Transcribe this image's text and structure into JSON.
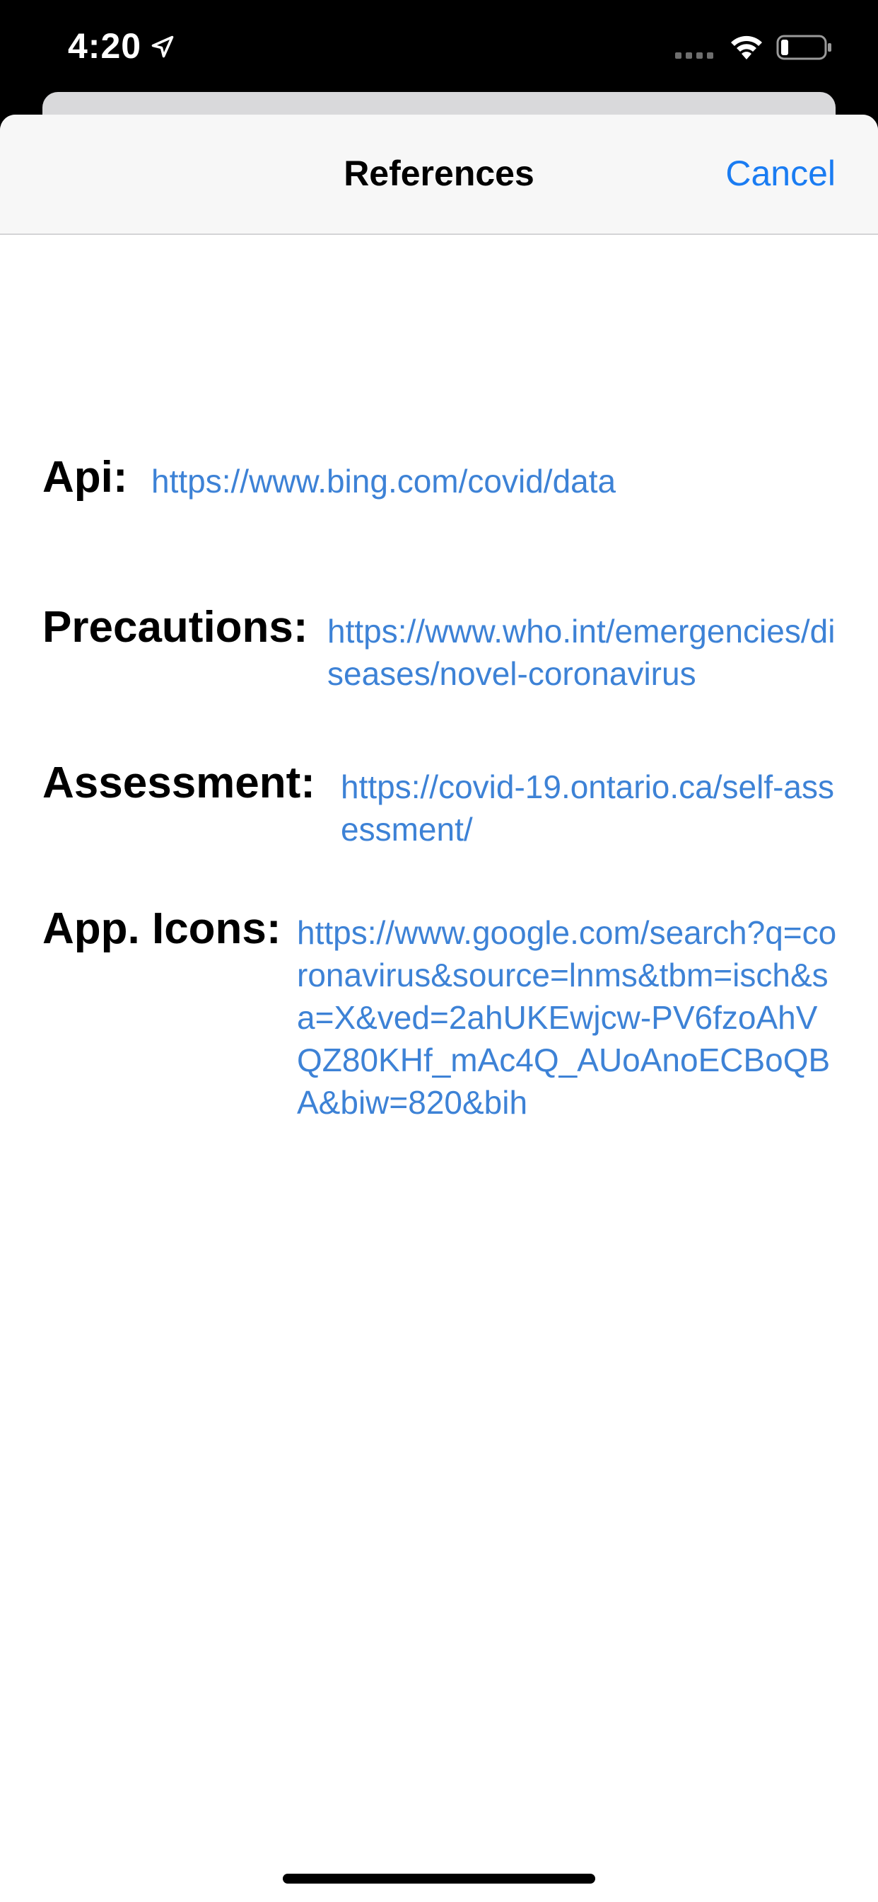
{
  "status_bar": {
    "time": "4:20",
    "icons": [
      "location-arrow-icon",
      "cellular-signal-icon",
      "wifi-icon",
      "battery-icon"
    ]
  },
  "nav": {
    "title": "References",
    "cancel_label": "Cancel"
  },
  "references": [
    {
      "label": "Api:",
      "url": "https://www.bing.com/covid/data"
    },
    {
      "label": "Precautions:",
      "url": "https://www.who.int/emergencies/diseases/novel-coronavirus"
    },
    {
      "label": "Assessment:",
      "url": "https://covid-19.ontario.ca/self-assessment/"
    },
    {
      "label": "App. Icons:",
      "url": "https://www.google.com/search?q=coronavirus&source=lnms&tbm=isch&sa=X&ved=2ahUKEwjcw-PV6fzoAhVQZ80KHf_mAc4Q_AUoAnoECBoQBA&biw=820&bih"
    }
  ],
  "colors": {
    "accent": "#1a7cf2",
    "link": "#3d82d6",
    "nav_background": "#f7f7f7"
  }
}
